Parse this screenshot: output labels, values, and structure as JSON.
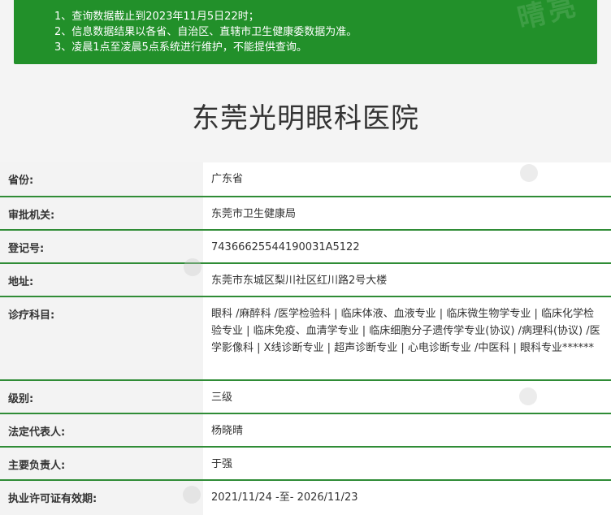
{
  "notice": {
    "lines": [
      "1、查询数据截止到2023年11月5日22时；",
      "2、信息数据结果以各省、自治区、直辖市卫生健康委数据为准。",
      "3、凌晨1点至凌晨5点系统进行维护，不能提供查询。"
    ],
    "watermark": "晴亮"
  },
  "hospital": {
    "name": "东莞光明眼科医院"
  },
  "fields": [
    {
      "label": "省份:",
      "value": "广东省"
    },
    {
      "label": "审批机关:",
      "value": "东莞市卫生健康局"
    },
    {
      "label": "登记号:",
      "value": "74366625544190031A5122"
    },
    {
      "label": "地址:",
      "value": "东莞市东城区梨川社区红川路2号大楼"
    },
    {
      "label": "诊疗科目:",
      "value": "眼科 /麻醉科 /医学检验科 | 临床体液、血液专业 | 临床微生物学专业 | 临床化学检验专业 | 临床免疫、血清学专业 | 临床细胞分子遗传学专业(协议) /病理科(协议) /医学影像科 | X线诊断专业 | 超声诊断专业 | 心电诊断专业 /中医科 | 眼科专业******"
    },
    {
      "label": "级别:",
      "value": "三级"
    },
    {
      "label": "法定代表人:",
      "value": "杨晓晴"
    },
    {
      "label": "主要负责人:",
      "value": "于强"
    },
    {
      "label": "执业许可证有效期:",
      "value": "2021/11/24 -至- 2026/11/23"
    }
  ]
}
